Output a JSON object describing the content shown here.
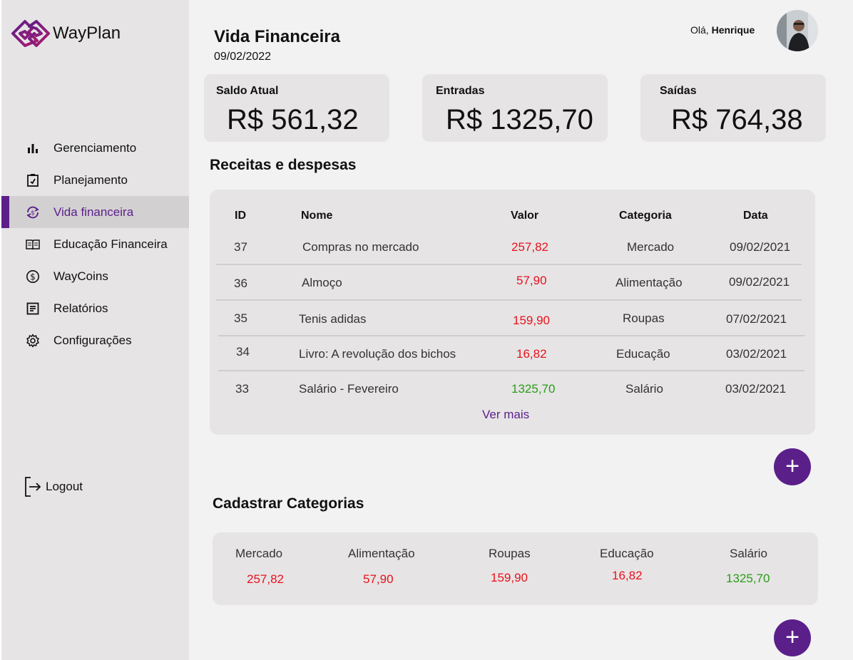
{
  "app": {
    "name": "WayPlan"
  },
  "sidebar": {
    "items": [
      {
        "label": "Gerenciamento",
        "icon": "bar-chart-icon",
        "active": false
      },
      {
        "label": "Planejamento",
        "icon": "clipboard-check-icon",
        "active": false
      },
      {
        "label": "Vida financeira",
        "icon": "currency-exchange-icon",
        "active": true
      },
      {
        "label": "Educação Financeira",
        "icon": "book-icon",
        "active": false
      },
      {
        "label": "WayCoins",
        "icon": "coin-icon",
        "active": false
      },
      {
        "label": "Relatórios",
        "icon": "report-icon",
        "active": false
      },
      {
        "label": "Configurações",
        "icon": "gear-icon",
        "active": false
      }
    ],
    "logout": "Logout"
  },
  "header": {
    "title": "Vida Financeira",
    "date": "09/02/2022",
    "greeting_prefix": "Olá,",
    "user_name": "Henrique"
  },
  "summary": {
    "balance": {
      "label": "Saldo Atual",
      "value": "R$ 561,32"
    },
    "income": {
      "label": "Entradas",
      "value": "R$ 1325,70"
    },
    "expenses": {
      "label": "Saídas",
      "value": "R$ 764,38"
    }
  },
  "transactions": {
    "title": "Receitas e despesas",
    "columns": {
      "id": "ID",
      "name": "Nome",
      "value": "Valor",
      "category": "Categoria",
      "date": "Data"
    },
    "rows": [
      {
        "id": "37",
        "name": "Compras no mercado",
        "value": "257,82",
        "type": "expense",
        "category": "Mercado",
        "date": "09/02/2021"
      },
      {
        "id": "36",
        "name": "Almoço",
        "value": "57,90",
        "type": "expense",
        "category": "Alimentação",
        "date": "09/02/2021"
      },
      {
        "id": "35",
        "name": "Tenis adidas",
        "value": "159,90",
        "type": "expense",
        "category": "Roupas",
        "date": "07/02/2021"
      },
      {
        "id": "34",
        "name": "Livro: A revolução dos bichos",
        "value": "16,82",
        "type": "expense",
        "category": "Educação",
        "date": "03/02/2021"
      },
      {
        "id": "33",
        "name": "Salário - Fevereiro",
        "value": "1325,70",
        "type": "income",
        "category": "Salário",
        "date": "03/02/2021"
      }
    ],
    "more": "Ver mais",
    "add_label": "+"
  },
  "categories": {
    "title": "Cadastrar Categorias",
    "items": [
      {
        "name": "Mercado",
        "value": "257,82",
        "type": "expense"
      },
      {
        "name": "Alimentação",
        "value": "57,90",
        "type": "expense"
      },
      {
        "name": "Roupas",
        "value": "159,90",
        "type": "expense"
      },
      {
        "name": "Educação",
        "value": "16,82",
        "type": "expense"
      },
      {
        "name": "Salário",
        "value": "1325,70",
        "type": "income"
      }
    ],
    "add_label": "+"
  },
  "colors": {
    "accent": "#5b1f8a",
    "expense": "#e8111b",
    "income": "#2a9d18",
    "panel": "#e6e4e5"
  }
}
